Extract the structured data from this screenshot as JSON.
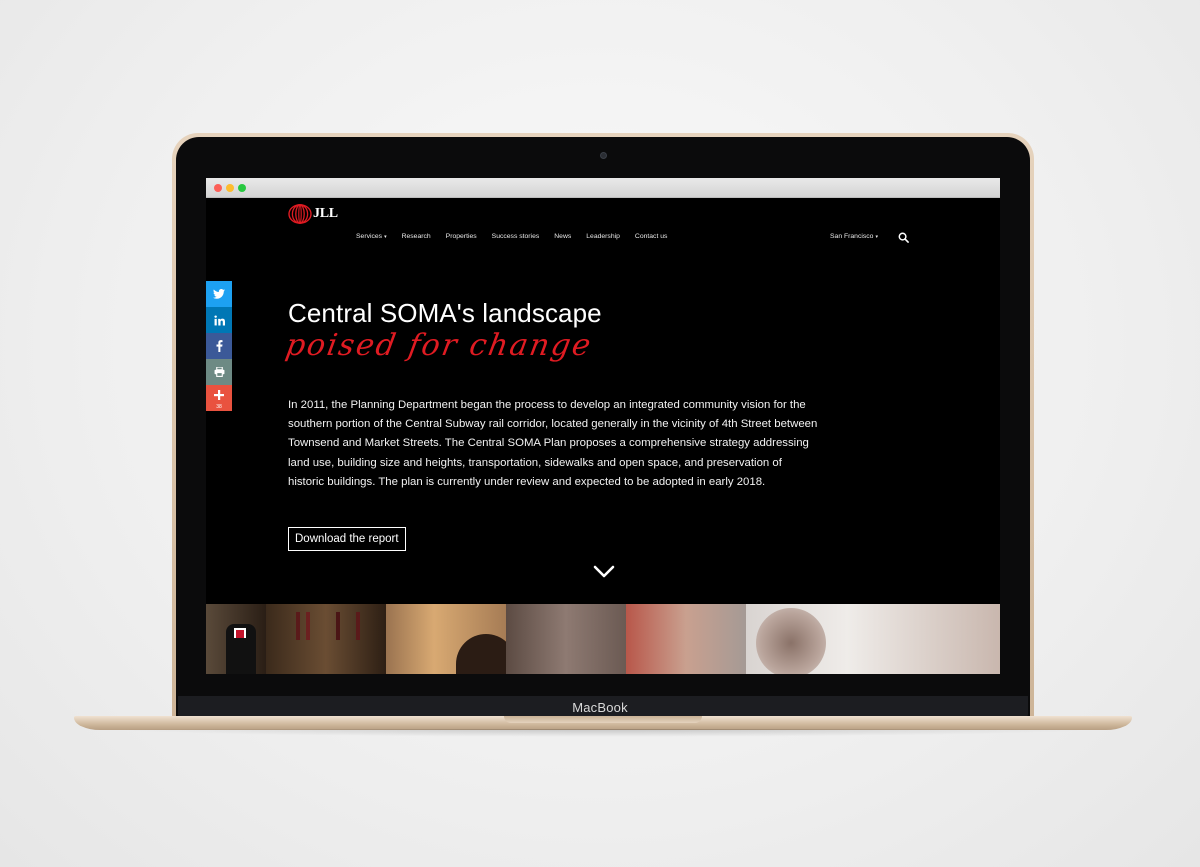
{
  "device": {
    "brand_label": "MacBook"
  },
  "nav": {
    "logo_text": "JLL",
    "links": [
      {
        "label": "Services",
        "dropdown": true
      },
      {
        "label": "Research",
        "dropdown": false
      },
      {
        "label": "Properties",
        "dropdown": false
      },
      {
        "label": "Success stories",
        "dropdown": false
      },
      {
        "label": "News",
        "dropdown": false
      },
      {
        "label": "Leadership",
        "dropdown": false
      },
      {
        "label": "Contact us",
        "dropdown": false
      }
    ],
    "city": "San Francisco",
    "caret": "▾"
  },
  "share": {
    "buttons": [
      {
        "icon": "twitter-icon",
        "color": "#1da1f2"
      },
      {
        "icon": "linkedin-icon",
        "color": "#0077b5"
      },
      {
        "icon": "facebook-icon",
        "color": "#3b5998"
      },
      {
        "icon": "print-icon",
        "color": "#6d8a84"
      },
      {
        "icon": "plus-icon",
        "color": "#e9523f",
        "count": "38"
      }
    ]
  },
  "hero": {
    "title": "Central SOMA's landscape",
    "script": "poised for change",
    "body": "In 2011, the Planning Department began the process to develop an integrated community vision for the southern portion of the Central Subway rail corridor, located generally in the vicinity of 4th Street between Townsend and Market Streets. The Central SOMA Plan proposes a comprehensive strategy addressing land use, building size and heights, transportation, sidewalks and open space, and preservation of historic buildings. The plan is currently under review and expected to be adopted in early 2018.",
    "cta_label": "Download the report"
  },
  "colors": {
    "accent": "#e01b22",
    "background": "#000000"
  }
}
